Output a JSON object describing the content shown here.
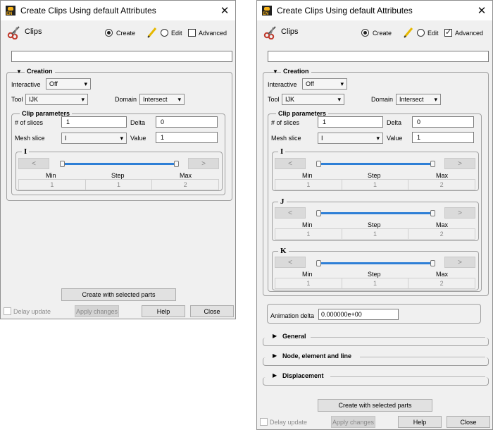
{
  "left": {
    "title": "Create Clips Using default Attributes",
    "header": {
      "clips": "Clips",
      "create": "Create",
      "edit": "Edit",
      "advanced": "Advanced"
    },
    "name_value": "",
    "creation": {
      "title": "Creation",
      "interactive_label": "Interactive",
      "interactive_value": "Off",
      "tool_label": "Tool",
      "tool_value": "IJK",
      "domain_label": "Domain",
      "domain_value": "Intersect"
    },
    "clip": {
      "title": "Clip parameters",
      "slices_label": "# of slices",
      "slices_value": "1",
      "delta_label": "Delta",
      "delta_value": "0",
      "mesh_label": "Mesh slice",
      "mesh_value": "I",
      "value_label": "Value",
      "value_value": "1"
    },
    "sliders": [
      {
        "name": "I",
        "prev": "<",
        "next": ">",
        "min": "Min",
        "step": "Step",
        "max": "Max",
        "vals": [
          "1",
          "1",
          "2"
        ]
      }
    ],
    "footer": {
      "create_btn": "Create with selected parts",
      "delay": "Delay update",
      "apply": "Apply changes",
      "help": "Help",
      "close": "Close"
    }
  },
  "right": {
    "title": "Create Clips Using default Attributes",
    "header": {
      "clips": "Clips",
      "create": "Create",
      "edit": "Edit",
      "advanced": "Advanced"
    },
    "name_value": "",
    "creation": {
      "title": "Creation",
      "interactive_label": "Interactive",
      "interactive_value": "Off",
      "tool_label": "Tool",
      "tool_value": "IJK",
      "domain_label": "Domain",
      "domain_value": "Intersect"
    },
    "clip": {
      "title": "Clip parameters",
      "slices_label": "# of slices",
      "slices_value": "1",
      "delta_label": "Delta",
      "delta_value": "0",
      "mesh_label": "Mesh slice",
      "mesh_value": "I",
      "value_label": "Value",
      "value_value": "1"
    },
    "sliders": [
      {
        "name": "I",
        "prev": "<",
        "next": ">",
        "min": "Min",
        "step": "Step",
        "max": "Max",
        "vals": [
          "1",
          "1",
          "2"
        ]
      },
      {
        "name": "J",
        "prev": "<",
        "next": ">",
        "min": "Min",
        "step": "Step",
        "max": "Max",
        "vals": [
          "1",
          "1",
          "2"
        ]
      },
      {
        "name": "K",
        "prev": "<",
        "next": ">",
        "min": "Min",
        "step": "Step",
        "max": "Max",
        "vals": [
          "1",
          "1",
          "2"
        ]
      }
    ],
    "animation": {
      "label": "Animation delta",
      "value": "0.000000e+00"
    },
    "sections": [
      "General",
      "Node, element and line",
      "Displacement"
    ],
    "footer": {
      "create_btn": "Create with selected parts",
      "delay": "Delay update",
      "apply": "Apply changes",
      "help": "Help",
      "close": "Close"
    }
  }
}
